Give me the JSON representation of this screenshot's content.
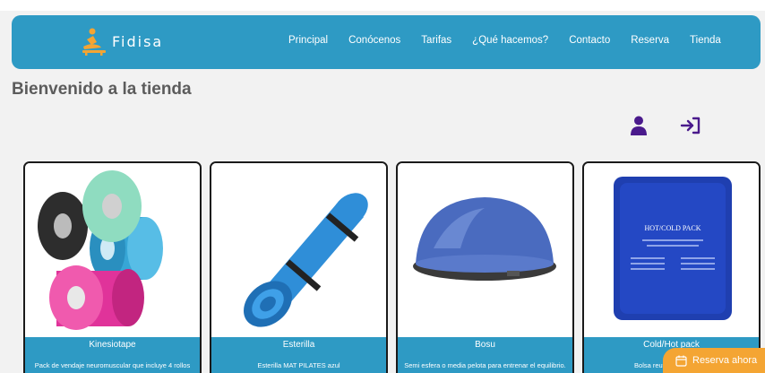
{
  "brand": {
    "name": "Fidisa",
    "icon": "physio-logo-icon"
  },
  "nav": {
    "items": [
      {
        "label": "Principal"
      },
      {
        "label": "Conócenos"
      },
      {
        "label": "Tarifas"
      },
      {
        "label": "¿Qué hacemos?"
      },
      {
        "label": "Contacto"
      },
      {
        "label": "Reserva"
      },
      {
        "label": "Tienda"
      }
    ]
  },
  "page": {
    "title": "Bienvenido a la tienda"
  },
  "icons": {
    "user": "user-icon",
    "login": "login-icon"
  },
  "products": [
    {
      "name": "Kinesiotape",
      "description": "Pack de vendaje neuromuscular que incluye 4 rollos"
    },
    {
      "name": "Esterilla",
      "description": "Esterilla MAT PILATES azul"
    },
    {
      "name": "Bosu",
      "description": "Semi esfera o media pelota para entrenar el equilibrio."
    },
    {
      "name": "Cold/Hot pack",
      "description": "Bolsa reutilizable con gel",
      "image_text": "HOT/COLD PACK"
    }
  ],
  "reserve": {
    "label": "Reserva ahora"
  },
  "colors": {
    "primary": "#2e9ac4",
    "accent": "#f4a533",
    "icon_purple": "#4a1a8c",
    "title_gray": "#5c5c5c",
    "background": "#f2f2f2"
  }
}
